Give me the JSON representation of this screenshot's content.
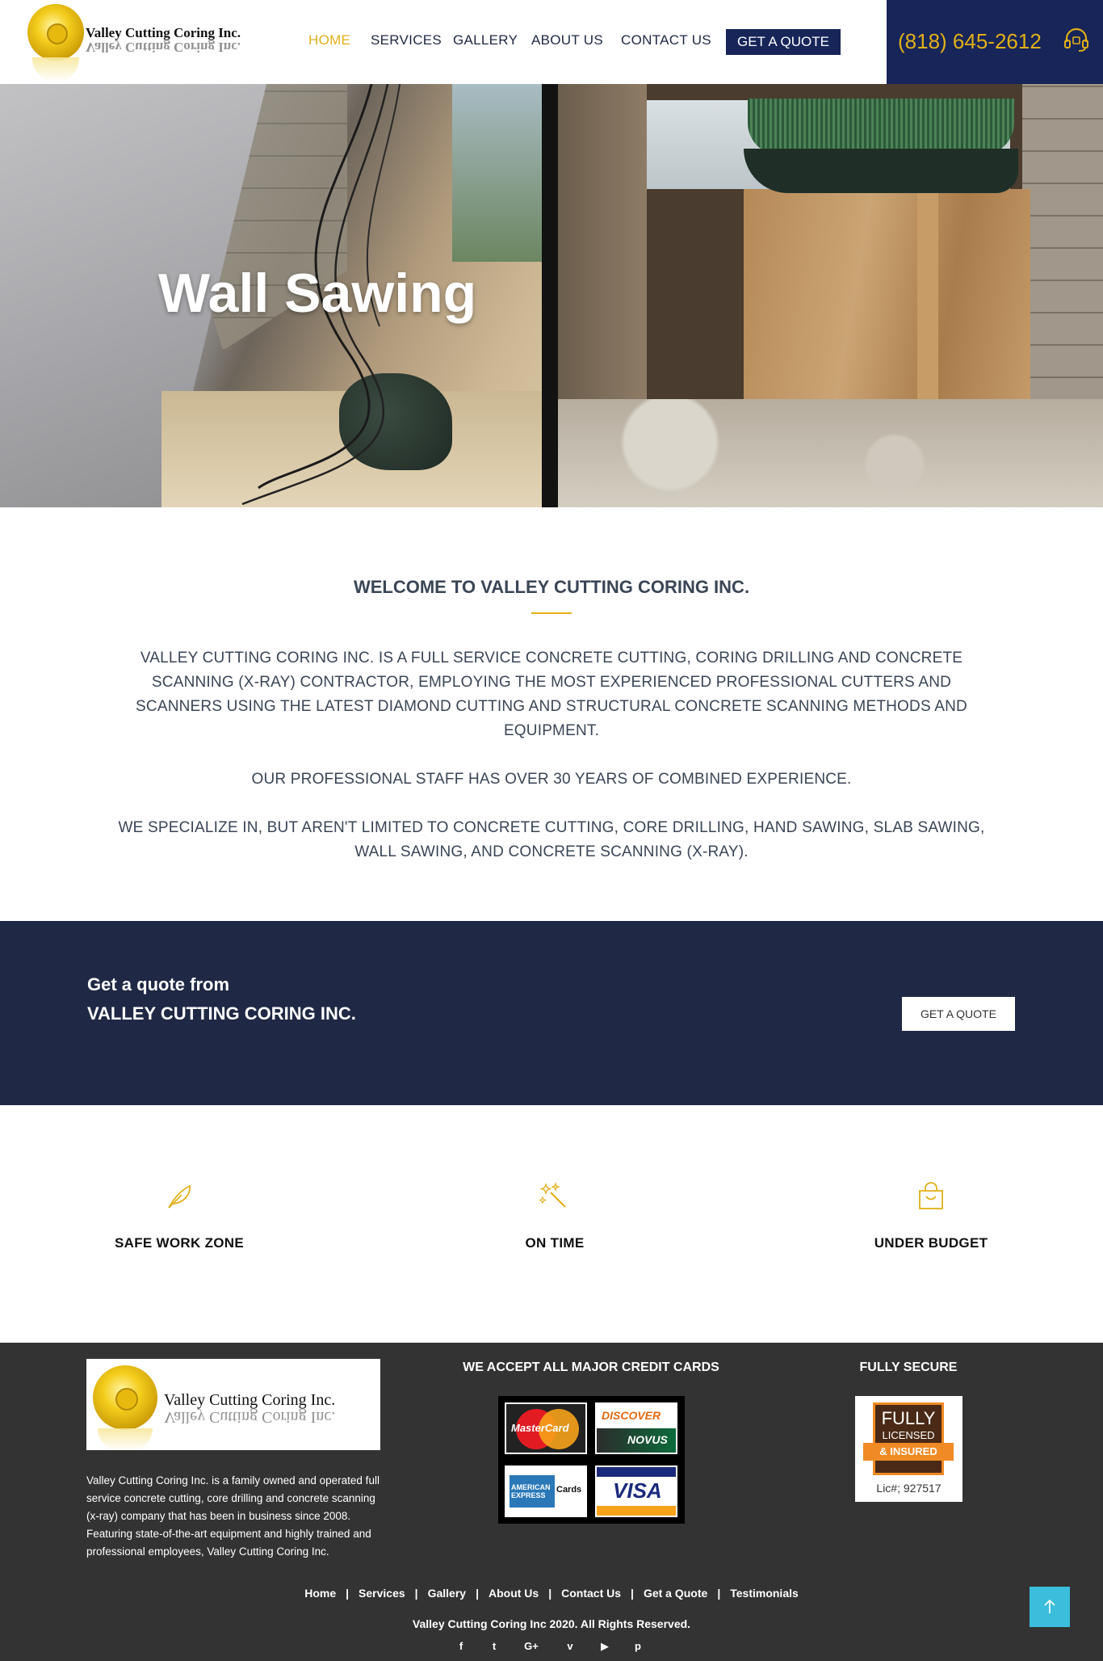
{
  "brand": {
    "name": "Valley Cutting Coring Inc."
  },
  "colors": {
    "accent": "#e1b019",
    "navy": "#172559",
    "band": "#1f2844",
    "footer": "#333333",
    "to_top": "#3bbedb"
  },
  "nav": {
    "items": [
      {
        "label": "HOME",
        "active": true
      },
      {
        "label": "SERVICES",
        "active": false
      },
      {
        "label": "GALLERY",
        "active": false
      },
      {
        "label": "ABOUT US",
        "active": false
      },
      {
        "label": "CONTACT US",
        "active": false
      }
    ],
    "quote_button": "GET A QUOTE",
    "phone": "(818) 645-2612",
    "phone_icon": "headset-icon"
  },
  "hero": {
    "title": "Wall Sawing"
  },
  "welcome": {
    "title": "WELCOME TO VALLEY CUTTING CORING INC.",
    "paragraphs": [
      "VALLEY CUTTING CORING INC. IS A FULL SERVICE CONCRETE CUTTING, CORING DRILLING AND CONCRETE SCANNING (X-RAY) CONTRACTOR, EMPLOYING THE MOST EXPERIENCED PROFESSIONAL CUTTERS AND SCANNERS USING THE LATEST DIAMOND CUTTING AND STRUCTURAL CONCRETE SCANNING METHODS AND EQUIPMENT.",
      "OUR PROFESSIONAL STAFF HAS OVER 30 YEARS OF COMBINED EXPERIENCE.",
      "WE SPECIALIZE IN, BUT AREN'T LIMITED TO CONCRETE CUTTING, CORE DRILLING, HAND SAWING, SLAB SAWING, WALL SAWING, AND CONCRETE SCANNING (X-RAY)."
    ]
  },
  "quote_band": {
    "line1": "Get a quote from",
    "line2": "VALLEY CUTTING CORING INC.",
    "button": "GET A QUOTE"
  },
  "features": [
    {
      "label": "SAFE WORK ZONE",
      "icon": "feather-icon"
    },
    {
      "label": "ON TIME",
      "icon": "magic-wand-icon"
    },
    {
      "label": "UNDER BUDGET",
      "icon": "shopping-bag-icon"
    }
  ],
  "footer": {
    "about": "Valley Cutting Coring Inc. is a family owned and operated full service concrete cutting, core drilling and concrete scanning (x-ray) company that has been in business since 2008. Featuring state-of-the-art equipment and highly trained and professional employees, Valley Cutting Coring Inc.",
    "cards_heading": "WE ACCEPT ALL MAJOR CREDIT CARDS",
    "secure_heading": "FULLY SECURE",
    "cards": {
      "mastercard": "MasterCard",
      "discover": "DISCOVER",
      "novus": "NOVUS",
      "amex": "AMERICAN EXPRESS",
      "amex_cards": "Cards",
      "visa": "VISA"
    },
    "badge": {
      "line1": "FULLY",
      "line2": "LICENSED",
      "ribbon": "& INSURED",
      "license": "Lic#; 927517"
    },
    "links": [
      "Home",
      "Services",
      "Gallery",
      "About Us",
      "Contact Us",
      "Get a Quote",
      "Testimonials"
    ],
    "link_separator": "|",
    "copyright": "Valley Cutting Coring Inc 2020. All Rights Reserved.",
    "social": [
      {
        "icon": "facebook-icon",
        "glyph": "f"
      },
      {
        "icon": "twitter-icon",
        "glyph": "t"
      },
      {
        "icon": "google-plus-icon",
        "glyph": "G+"
      },
      {
        "icon": "vimeo-icon",
        "glyph": "v"
      },
      {
        "icon": "youtube-icon",
        "glyph": "▶"
      },
      {
        "icon": "pinterest-icon",
        "glyph": "p"
      }
    ],
    "to_top_icon": "arrow-up-icon"
  }
}
